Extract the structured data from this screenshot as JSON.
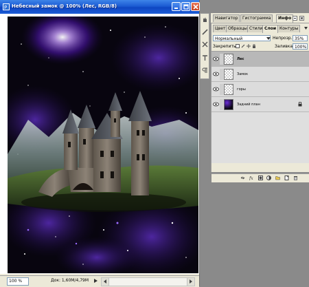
{
  "document": {
    "title": "Небесный замок @ 100% (Лес, RGB/8)",
    "zoom": "100 %",
    "doc_info": "Док: 1,60М/4,79М"
  },
  "tool_icons": [
    "hand-pan-icon",
    "brush-icon",
    "tools-icon",
    "text-icon",
    "paragraph-icon"
  ],
  "panels": {
    "top_tabs": [
      "Навигатор",
      "Гистограмма",
      "Инфо"
    ],
    "layer_tabs": [
      "Цвет",
      "Образцы",
      "Стили",
      "Слои",
      "Контуры"
    ],
    "active_layer_tab": "Слои"
  },
  "layers": {
    "blend_mode": "Нормальный",
    "opacity_label": "Непрозр.:",
    "opacity_value": "35%",
    "lock_label": "Закрепить:",
    "fill_label": "Заливка:",
    "fill_value": "100%",
    "items": [
      {
        "name": "Лес",
        "selected": true
      },
      {
        "name": "Замок",
        "selected": false
      },
      {
        "name": "горы",
        "selected": false
      },
      {
        "name": "Задний план",
        "selected": false,
        "locked": true
      }
    ]
  },
  "colors": {
    "titlebar": "#1b5bd3",
    "close_button": "#c8401c",
    "window_bg": "#ece9d8",
    "space": "#0a0612",
    "nebula": "#7a2cff"
  }
}
